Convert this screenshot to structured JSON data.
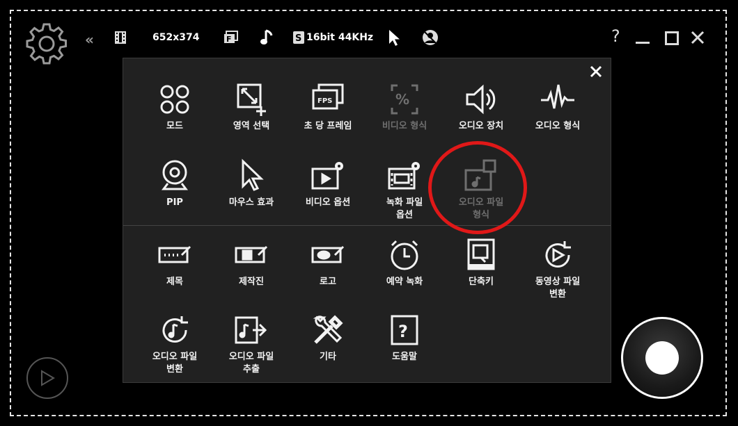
{
  "toolbar": {
    "resolution": "652x374",
    "audio_format": "16bit 44KHz",
    "help": "?",
    "icons": [
      "settings-gear-icon",
      "collapse-icon",
      "film-icon",
      "fullscreen-icon",
      "music-note-icon",
      "sound-icon",
      "cursor-icon",
      "webcam-icon",
      "help-icon",
      "minimize-icon",
      "maximize-icon",
      "close-icon"
    ]
  },
  "menu": {
    "items": [
      {
        "label": "모드",
        "icon": "mode-icon",
        "enabled": true
      },
      {
        "label": "영역 선택",
        "icon": "area-select-icon",
        "enabled": true
      },
      {
        "label": "초 당 프레임",
        "icon": "fps-icon",
        "enabled": true
      },
      {
        "label": "비디오 형식",
        "icon": "video-format-icon",
        "enabled": false
      },
      {
        "label": "오디오 장치",
        "icon": "speaker-icon",
        "enabled": true
      },
      {
        "label": "오디오 형식",
        "icon": "waveform-icon",
        "enabled": true
      },
      {
        "label": "PIP",
        "icon": "webcam-icon",
        "enabled": true
      },
      {
        "label": "마우스 효과",
        "icon": "cursor-icon",
        "enabled": true
      },
      {
        "label": "비디오 옵션",
        "icon": "video-options-icon",
        "enabled": true
      },
      {
        "label": "녹화 파일\n옵션",
        "icon": "record-file-options-icon",
        "enabled": true
      },
      {
        "label": "오디오 파일\n형식",
        "icon": "audio-file-format-icon",
        "enabled": false
      },
      {
        "label": "제목",
        "icon": "title-icon",
        "enabled": true
      },
      {
        "label": "제작진",
        "icon": "credits-icon",
        "enabled": true
      },
      {
        "label": "로고",
        "icon": "logo-icon",
        "enabled": true
      },
      {
        "label": "예약 녹화",
        "icon": "clock-icon",
        "enabled": true
      },
      {
        "label": "단축키",
        "icon": "hotkey-icon",
        "enabled": true
      },
      {
        "label": "동영상 파일\n변환",
        "icon": "video-convert-icon",
        "enabled": true
      },
      {
        "label": "오디오 파일\n변환",
        "icon": "audio-convert-icon",
        "enabled": true
      },
      {
        "label": "오디오 파일\n추출",
        "icon": "audio-extract-icon",
        "enabled": true
      },
      {
        "label": "기타",
        "icon": "tools-icon",
        "enabled": true
      },
      {
        "label": "도움말",
        "icon": "help-box-icon",
        "enabled": true
      }
    ]
  },
  "colors": {
    "background": "#000000",
    "panel": "#212121",
    "highlight": "#e01818",
    "disabled": "#6f6f6f"
  }
}
